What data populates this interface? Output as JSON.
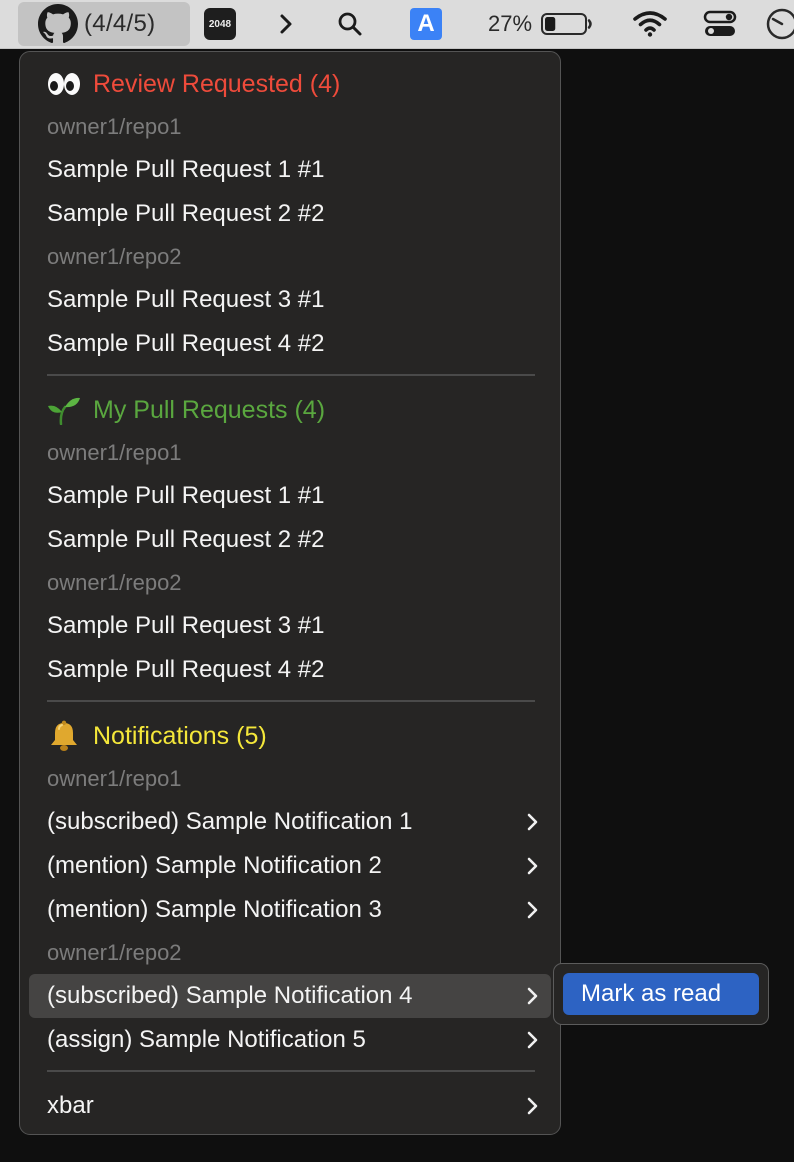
{
  "menubar": {
    "github_count": "(4/4/5)",
    "app_2048_label": "2048",
    "input_source_label": "A",
    "battery_percent": "27%",
    "battery_level": 0.27,
    "icons": [
      "github-icon",
      "app-2048-icon",
      "chevron-right-icon",
      "search-icon",
      "input-source-icon",
      "battery-icon",
      "wifi-icon",
      "control-center-icon",
      "clock-icon"
    ]
  },
  "menu": {
    "review": {
      "emoji": "eyes",
      "title": "Review Requested (4)",
      "color": "#ee4b3b",
      "repos": [
        {
          "name": "owner1/repo1",
          "items": [
            "Sample Pull Request 1 #1",
            "Sample Pull Request 2 #2"
          ]
        },
        {
          "name": "owner1/repo2",
          "items": [
            "Sample Pull Request 3 #1",
            "Sample Pull Request 4 #2"
          ]
        }
      ]
    },
    "mine": {
      "emoji": "seedling",
      "title": "My Pull Requests (4)",
      "color": "#5aa73f",
      "repos": [
        {
          "name": "owner1/repo1",
          "items": [
            "Sample Pull Request 1  #1",
            "Sample Pull Request 2  #2"
          ]
        },
        {
          "name": "owner1/repo2",
          "items": [
            "Sample Pull Request 3  #1",
            "Sample Pull Request 4  #2"
          ]
        }
      ]
    },
    "notifications": {
      "emoji": "bell",
      "title": "Notifications (5)",
      "color": "#f4e73a",
      "repos": [
        {
          "name": "owner1/repo1",
          "items": [
            "(subscribed) Sample Notification 1",
            "(mention) Sample Notification 2",
            "(mention) Sample Notification 3"
          ]
        },
        {
          "name": "owner1/repo2",
          "items": [
            "(subscribed) Sample Notification 4",
            "(assign) Sample Notification 5"
          ]
        }
      ]
    },
    "footer": {
      "label": "xbar"
    }
  },
  "submenu": {
    "mark_as_read": "Mark as read"
  }
}
